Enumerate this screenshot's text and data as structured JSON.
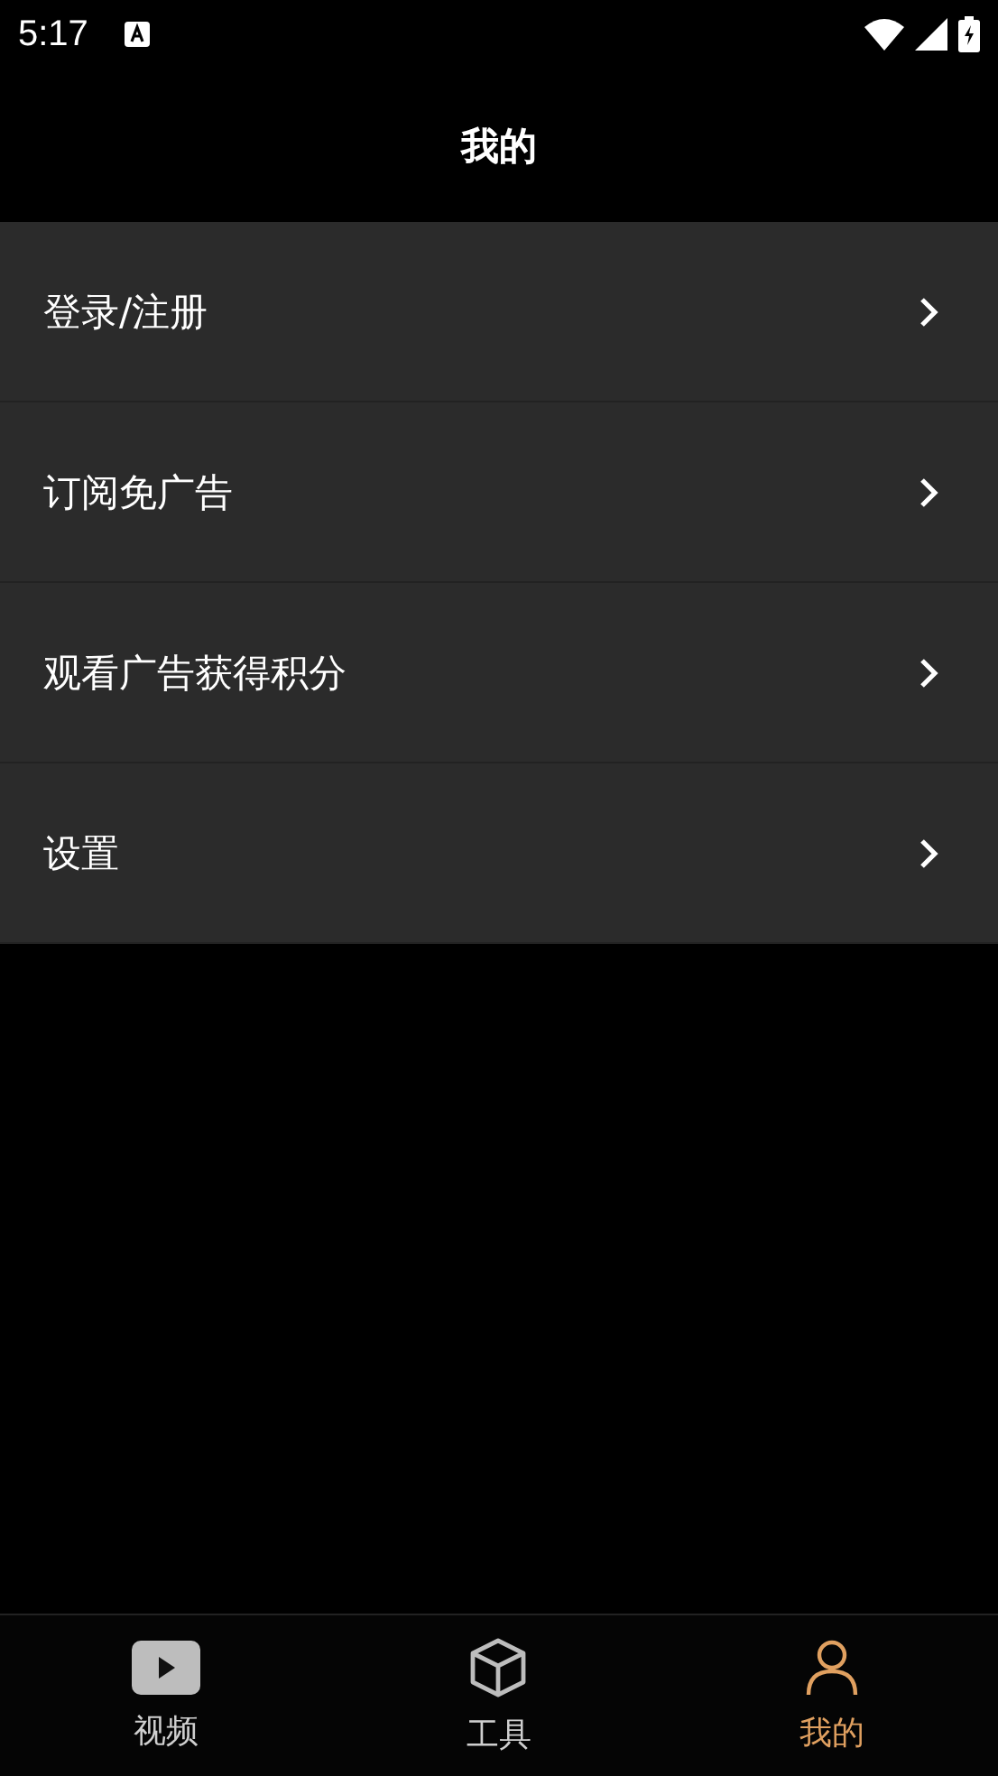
{
  "status_bar": {
    "time": "5:17"
  },
  "header": {
    "title": "我的"
  },
  "menu": [
    {
      "label": "登录/注册"
    },
    {
      "label": "订阅免广告"
    },
    {
      "label": "观看广告获得积分"
    },
    {
      "label": "设置"
    }
  ],
  "bottom_nav": [
    {
      "label": "视频",
      "kind": "video",
      "selected": false
    },
    {
      "label": "工具",
      "kind": "tools",
      "selected": false
    },
    {
      "label": "我的",
      "kind": "profile",
      "selected": true
    }
  ]
}
